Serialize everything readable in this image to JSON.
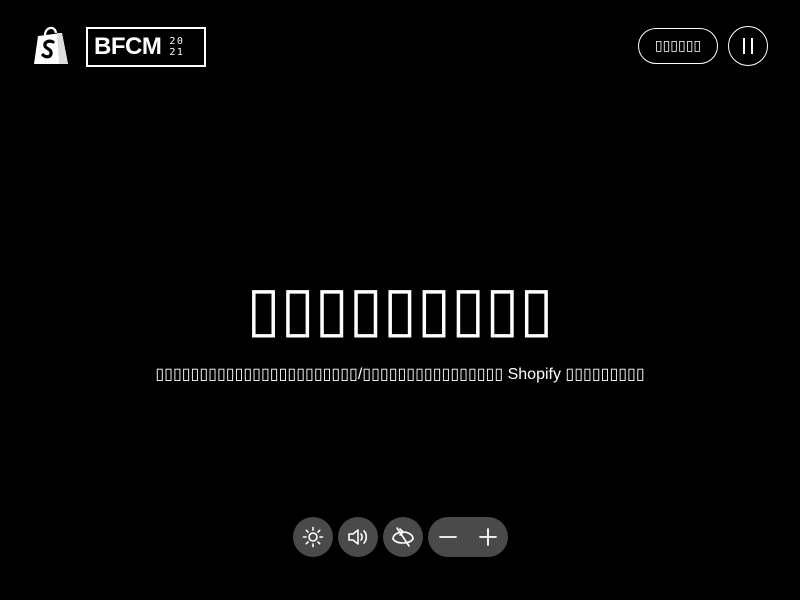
{
  "header": {
    "brand_icon": "shopify-bag-icon",
    "event_mark": {
      "title": "BFCM",
      "year_top": "20",
      "year_bottom": "21"
    },
    "language_button_label": "▯▯▯▯▯▯",
    "pause_button_icon": "pause-icon"
  },
  "main": {
    "headline": "▯▯▯▯▯▯▯▯▯",
    "subtitle": "▯▯▯▯▯▯▯▯▯▯▯▯▯▯▯▯▯▯▯▯▯▯▯/▯▯▯▯▯▯▯▯▯▯▯▯▯▯▯▯ Shopify ▯▯▯▯▯▯▯▯▯"
  },
  "controls": {
    "items": [
      {
        "icon": "brightness-icon"
      },
      {
        "icon": "volume-icon"
      },
      {
        "icon": "rotate-off-icon"
      },
      {
        "icon": "zoom-out-icon"
      },
      {
        "icon": "zoom-in-icon"
      }
    ]
  },
  "colors": {
    "background": "#000000",
    "foreground": "#ffffff",
    "control_fill": "#4a4a4a"
  }
}
